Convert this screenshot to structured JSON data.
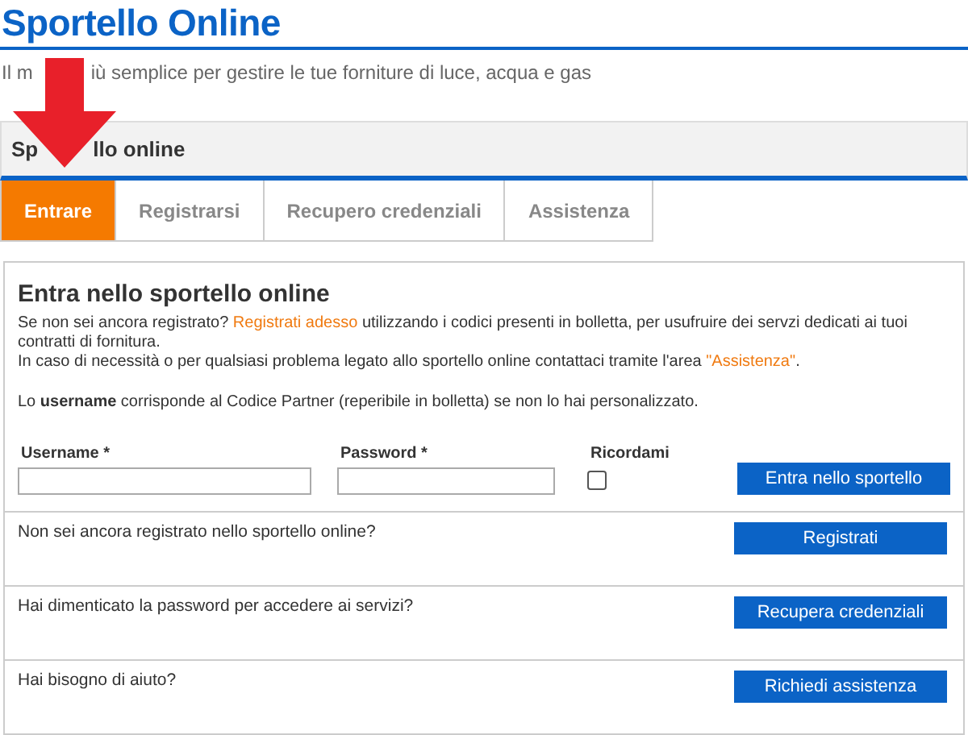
{
  "header": {
    "title": "Sportello Online",
    "subtitle": [
      "Il m",
      "iù semplice per gestire le tue forniture di luce, acqua e gas"
    ]
  },
  "panel": {
    "title": [
      "Sp",
      "llo online"
    ]
  },
  "tabs": [
    {
      "label": "Entrare",
      "selected": true
    },
    {
      "label": "Registrarsi",
      "selected": false
    },
    {
      "label": "Recupero credenziali",
      "selected": false
    },
    {
      "label": "Assistenza",
      "selected": false
    }
  ],
  "login": {
    "heading": "Entra nello sportello online",
    "intro": [
      [
        {
          "kind": "text",
          "text": "Se non sei ancora registrato? "
        },
        {
          "kind": "link",
          "text": "Registrati adesso"
        },
        {
          "kind": "text",
          "text": " utilizzando i codici presenti in bolletta, per usufruire dei servzi dedicati ai tuoi contratti di fornitura."
        }
      ],
      [
        {
          "kind": "text",
          "text": "In caso di necessità o per qualsiasi problema legato allo sportello online contattaci tramite l'area "
        },
        {
          "kind": "link",
          "text": "\"Assistenza\""
        },
        {
          "kind": "text",
          "text": "."
        }
      ]
    ],
    "note": "Lo **username** corrisponde al Codice Partner (reperibile in bolletta) se non lo hai personalizzato.",
    "username_label": "Username *",
    "password_label": "Password *",
    "remember_label": "Ricordami",
    "remember_checked": false,
    "submit": "Entra nello sportello"
  },
  "rows": [
    {
      "question": "Non sei ancora registrato nello sportello online?",
      "button": "Registrati"
    },
    {
      "question": "Hai dimenticato la password per accedere ai servizi?",
      "button": "Recupera credenziali"
    },
    {
      "question": "Hai bisogno di aiuto?",
      "button": "Richiedi assistenza"
    }
  ]
}
